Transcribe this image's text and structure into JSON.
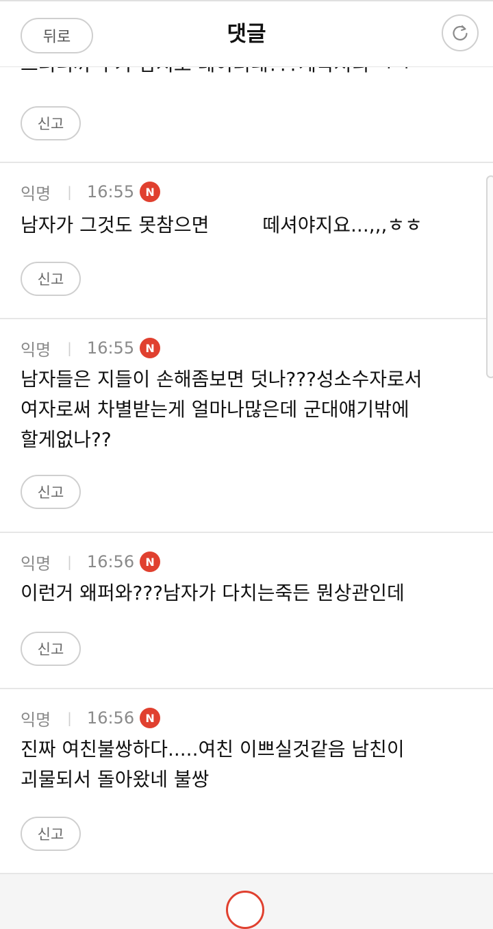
{
  "header": {
    "back_label": "뒤로",
    "title": "댓글",
    "refresh_icon": "refresh-icon"
  },
  "partial_comment": {
    "text": "그러니까 누가 참지도 데이터네???계속처리 ㅋㅋ",
    "report_label": "신고"
  },
  "comments": [
    {
      "author": "익명",
      "time": "16:55",
      "badge": "N",
      "text_before": "남자가 그것도 못참으면",
      "text_after": "떼셔야지요...,,,ㅎㅎ",
      "report_label": "신고"
    },
    {
      "author": "익명",
      "time": "16:55",
      "badge": "N",
      "text": "남자들은 지들이 손해좀보면 덧나???성소수자로서 여자로써 차별받는게 얼마나많은데 군대얘기밖에 할게없나??",
      "report_label": "신고"
    },
    {
      "author": "익명",
      "time": "16:56",
      "badge": "N",
      "text": "이런거 왜퍼와???남자가 다치는죽든 뭔상관인데",
      "report_label": "신고"
    },
    {
      "author": "익명",
      "time": "16:56",
      "badge": "N",
      "text": "진짜 여친불쌍하다.....여친 이쁘실것같음 남친이 괴물되서 돌아왔네 불쌍",
      "report_label": "신고"
    }
  ],
  "colors": {
    "badge": "#e0402f",
    "border": "#cfcfcf",
    "meta_text": "#8a8a8a"
  }
}
